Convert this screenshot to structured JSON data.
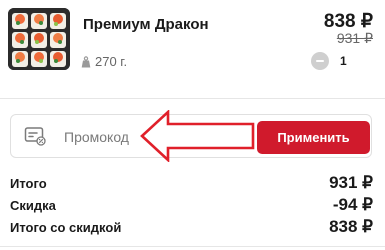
{
  "product": {
    "title": "Премиум Дракон",
    "weight": "270 г.",
    "price_current": "838 ₽",
    "price_old": "931 ₽",
    "quantity": "1",
    "weight_icon": "weight-icon",
    "minus_icon": "minus-icon"
  },
  "promo": {
    "placeholder": "Промокод",
    "apply_label": "Применить",
    "icon": "coupon-icon"
  },
  "summary": {
    "total_label": "Итого",
    "total_value": "931 ₽",
    "discount_label": "Скидка",
    "discount_value": "-94 ₽",
    "final_label": "Итого со скидкой",
    "final_value": "838 ₽"
  },
  "colors": {
    "accent": "#d01a2c",
    "arrow": "#e0202a"
  }
}
